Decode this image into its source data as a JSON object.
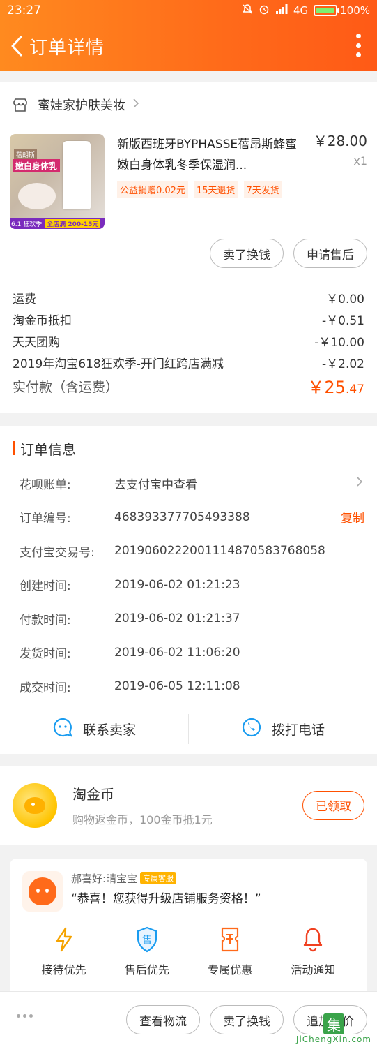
{
  "status": {
    "time": "23:27",
    "network": "4G",
    "battery": "100%",
    "battery_level": 1.0
  },
  "header": {
    "title": "订单详情"
  },
  "store": {
    "name": "蜜娃家护肤美妆"
  },
  "product": {
    "title": "新版西班牙BYPHASSE蓓昂斯蜂蜜嫩白身体乳冬季保湿润...",
    "price": "￥28.00",
    "qty": "x1",
    "tags": [
      "公益捐赠0.02元",
      "15天退货",
      "7天发货"
    ],
    "thumb_labels": {
      "brand": "蓓朗斯",
      "name": "嫩白身体乳",
      "promo": "6.1 狂欢季",
      "promo_deal": "全店满 200-15元"
    }
  },
  "product_actions": [
    "卖了换钱",
    "申请售后"
  ],
  "fees": [
    {
      "label": "运费",
      "value": "￥0.00"
    },
    {
      "label": "淘金币抵扣",
      "value": "-￥0.51"
    },
    {
      "label": "天天团购",
      "value": "-￥10.00"
    },
    {
      "label": "2019年淘宝618狂欢季-开门红跨店满减",
      "value": "-￥2.02"
    }
  ],
  "total": {
    "label": "实付款（含运费）",
    "currency": "￥",
    "int": "25",
    "dec": ".47"
  },
  "order_info": {
    "title": "订单信息",
    "rows": [
      {
        "k": "花呗账单:",
        "v": "去支付宝中查看"
      },
      {
        "k": "订单编号:",
        "v": "468393377705493388",
        "action": "复制"
      },
      {
        "k": "支付宝交易号:",
        "v": "2019060222001114870583768058"
      },
      {
        "k": "创建时间:",
        "v": "2019-06-02 01:21:23"
      },
      {
        "k": "付款时间:",
        "v": "2019-06-02 01:21:37"
      },
      {
        "k": "发货时间:",
        "v": "2019-06-02 11:06:20"
      },
      {
        "k": "成交时间:",
        "v": "2019-06-05 12:11:08"
      }
    ]
  },
  "contact": {
    "seller": "联系卖家",
    "call": "拨打电话"
  },
  "coins": {
    "title": "淘金币",
    "desc": "购物返金币，100金币抵1元",
    "button": "已领取"
  },
  "service": {
    "name": "郝喜好:晴宝宝",
    "badge": "专属客服",
    "message": "“恭喜！您获得升级店铺服务资格！”",
    "features": [
      "接待优先",
      "售后优先",
      "专属优惠",
      "活动通知"
    ]
  },
  "bottom": {
    "buttons": [
      "查看物流",
      "卖了换钱",
      "追加评价"
    ]
  },
  "watermark": {
    "text": "JiChengXin.com"
  },
  "colors": {
    "accent": "#ff5000",
    "header_start": "#ff8a1f",
    "header_end": "#ff5a16"
  }
}
